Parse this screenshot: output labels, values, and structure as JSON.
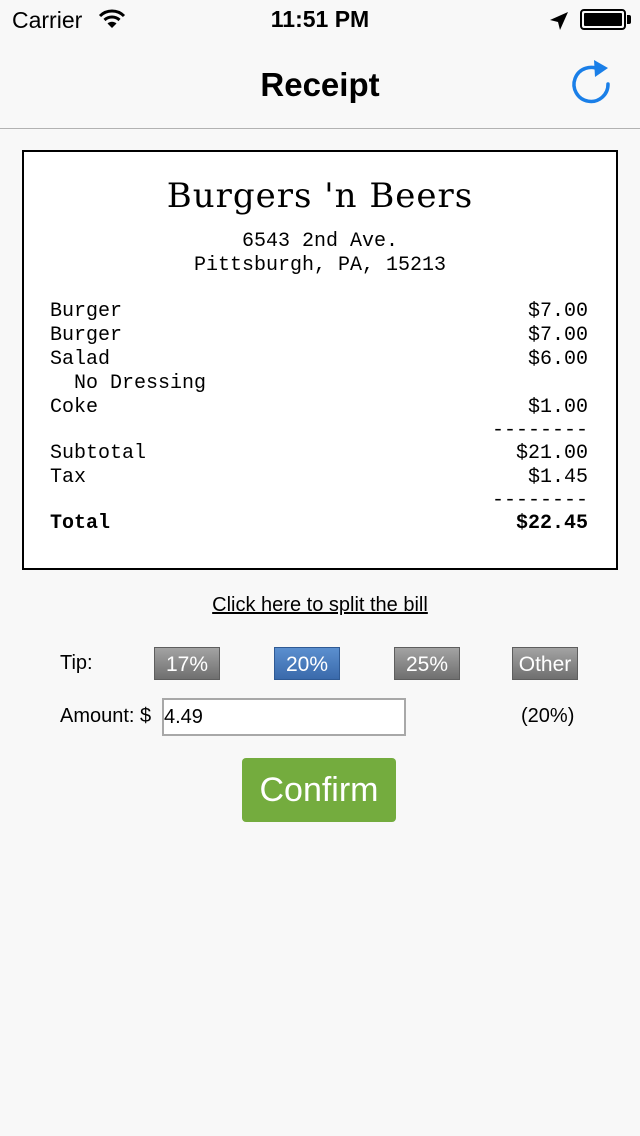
{
  "status_bar": {
    "carrier": "Carrier",
    "time": "11:51 PM",
    "battery_level": 1.0,
    "icons": [
      "wifi-icon",
      "location-arrow-icon",
      "battery-icon"
    ]
  },
  "nav": {
    "title": "Receipt",
    "refresh_icon": "refresh-icon",
    "accent_color": "#1a7fe8"
  },
  "receipt": {
    "restaurant": "Burgers 'n Beers",
    "address_line1": "6543 2nd Ave.",
    "address_line2": "Pittsburgh, PA, 15213",
    "items": [
      {
        "name": "Burger",
        "price": "$7.00"
      },
      {
        "name": "Burger",
        "price": "$7.00"
      },
      {
        "name": "Salad",
        "price": "$6.00"
      },
      {
        "name": "  No Dressing",
        "price": ""
      },
      {
        "name": "Coke",
        "price": "$1.00"
      }
    ],
    "divider": "--------",
    "subtotal_label": "Subtotal",
    "subtotal": "$21.00",
    "tax_label": "Tax",
    "tax": "$1.45",
    "total_label": "Total",
    "total": "$22.45"
  },
  "split_link": "Click here to split the bill",
  "tip": {
    "label": "Tip:",
    "options": [
      {
        "label": "17%",
        "selected": false
      },
      {
        "label": "20%",
        "selected": true
      },
      {
        "label": "25%",
        "selected": false
      },
      {
        "label": "Other",
        "selected": false
      }
    ],
    "selected_color": "#4a7dbf",
    "unselected_color": "#8a8a8a"
  },
  "amount": {
    "label": "Amount: $",
    "value": "4.49",
    "percent": "(20%)"
  },
  "confirm": {
    "label": "Confirm",
    "color": "#74ac3e"
  }
}
